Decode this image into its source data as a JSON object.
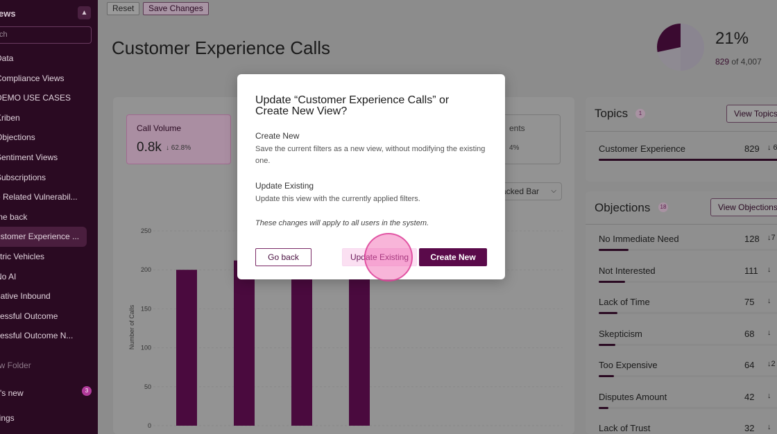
{
  "sidebar": {
    "title": "ews",
    "search_placeholder": "ch",
    "items": [
      {
        "label": "Data"
      },
      {
        "label": "Compliance Views"
      },
      {
        "label": "DEMO USE CASES"
      },
      {
        "label": "Kriben"
      },
      {
        "label": "Objections"
      },
      {
        "label": "Sentiment Views"
      },
      {
        "label": "Subscriptions"
      },
      {
        "label": "e Related Vulnerabil..."
      },
      {
        "label": "me back"
      },
      {
        "label": "ustomer Experience ..."
      },
      {
        "label": "ctric Vehicles"
      },
      {
        "label": "No AI"
      },
      {
        "label": "gative Inbound"
      },
      {
        "label": "cessful Outcome"
      },
      {
        "label": "cessful Outcome N..."
      }
    ],
    "new_folder": "ew Folder",
    "whats_new": "at's new",
    "whats_new_badge": "3",
    "settings": "ttings"
  },
  "toolbar": {
    "reset_label": "Reset",
    "save_label": "Save Changes"
  },
  "page": {
    "title": "Customer Experience Calls",
    "percent": "21%",
    "count": "829",
    "count_of": " of 4,007"
  },
  "stats": {
    "call_volume_label": "Call Volume",
    "call_volume_value": "0.8k",
    "call_volume_delta": "↓ 62.8%",
    "partial_label": "ents",
    "partial_delta": "4%"
  },
  "chart_selector": {
    "value": "acked Bar"
  },
  "chart_data": {
    "type": "bar",
    "ylabel": "Number of Calls",
    "ylim": [
      0,
      250
    ],
    "yticks": [
      "0",
      "50",
      "100",
      "150",
      "200",
      "250"
    ],
    "categories": [
      "",
      "",
      "",
      ""
    ],
    "values": [
      200,
      212,
      205,
      210
    ],
    "bar_color": "#4a0a3e"
  },
  "topics": {
    "title": "Topics",
    "count": "1",
    "button": "View Topics",
    "rows": [
      {
        "label": "Customer Experience",
        "value": "829",
        "arrow": "↓ 6",
        "fill": 1.0
      }
    ]
  },
  "objections": {
    "title": "Objections",
    "count": "18",
    "button": "View Objections",
    "rows": [
      {
        "label": "No Immediate Need",
        "value": "128",
        "arrow": "↓7",
        "fill": 0.16
      },
      {
        "label": "Not Interested",
        "value": "111",
        "arrow": "↓",
        "fill": 0.14
      },
      {
        "label": "Lack of Time",
        "value": "75",
        "arrow": "↓",
        "fill": 0.1
      },
      {
        "label": "Skepticism",
        "value": "68",
        "arrow": "↓",
        "fill": 0.09
      },
      {
        "label": "Too Expensive",
        "value": "64",
        "arrow": "↓2",
        "fill": 0.08
      },
      {
        "label": "Disputes Amount",
        "value": "42",
        "arrow": "↓",
        "fill": 0.05
      },
      {
        "label": "Lack of Trust",
        "value": "32",
        "arrow": "↓",
        "fill": 0.04
      }
    ]
  },
  "modal": {
    "title": "Update “Customer Experience Calls” or Create New View?",
    "create_heading": "Create New",
    "create_desc": "Save the current filters as a new view, without modifying the existing one.",
    "update_heading": "Update Existing",
    "update_desc": "Update this view with the currently applied filters.",
    "note": "These changes will apply to all users in the system.",
    "go_back": "Go back",
    "update_existing": "Update Existing",
    "create_new": "Create New"
  },
  "colors": {
    "brand": "#5a0a4a",
    "sidebar_bg": "#2a0a22",
    "overlay_dim": "#8c8c8c"
  }
}
